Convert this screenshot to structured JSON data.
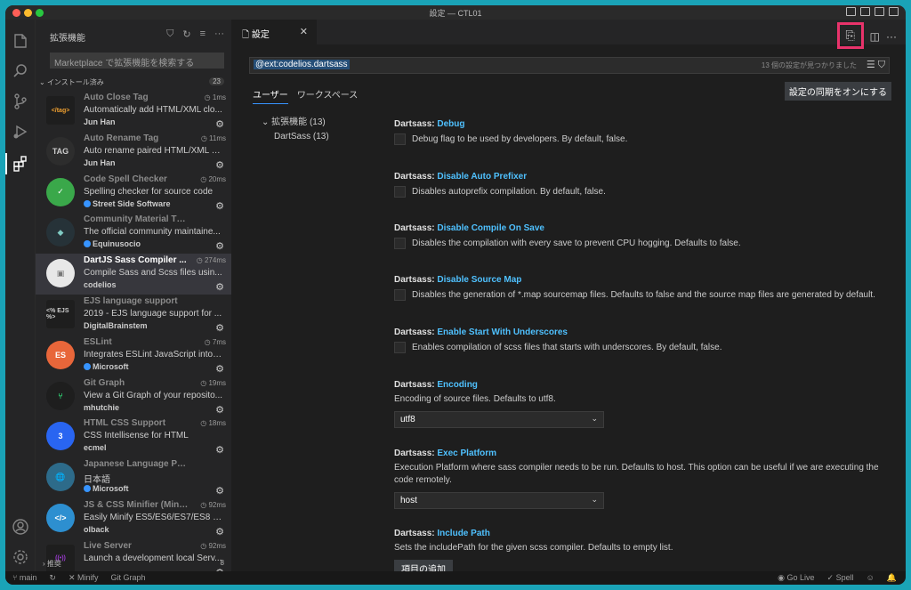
{
  "window": {
    "title": "設定 — CTL01",
    "traffic_colors": [
      "#ff5f57",
      "#febc2e",
      "#28c840"
    ]
  },
  "activity_bar": {
    "items": [
      {
        "name": "explorer-icon",
        "glyph": "❐"
      },
      {
        "name": "search-icon",
        "glyph": "⌕"
      },
      {
        "name": "source-control-icon",
        "glyph": "⑂"
      },
      {
        "name": "run-debug-icon",
        "glyph": "▷"
      },
      {
        "name": "extensions-icon",
        "glyph": "⊞"
      }
    ],
    "bottom": [
      {
        "name": "account-icon",
        "glyph": "◯"
      },
      {
        "name": "manage-gear-icon",
        "glyph": "⚙"
      }
    ]
  },
  "sidebar": {
    "header": "拡張機能",
    "search_placeholder": "Marketplace で拡張機能を検索する",
    "installed_label": "インストール済み",
    "installed_count": "23",
    "recommended_label": "推奨",
    "recommended_count": "8",
    "extensions": [
      {
        "name": "Auto Close Tag",
        "time": "1ms",
        "desc": "Automatically add HTML/XML clo...",
        "publisher": "Jun Han",
        "verified": false,
        "icon_text": "</tag>",
        "icon_bg": "#1e1e1e",
        "icon_color": "#f0a030"
      },
      {
        "name": "Auto Rename Tag",
        "time": "11ms",
        "desc": "Auto rename paired HTML/XML tag",
        "publisher": "Jun Han",
        "verified": false,
        "icon_text": "TAG",
        "icon_bg": "#2d2d2d",
        "icon_color": "#cccccc"
      },
      {
        "name": "Code Spell Checker",
        "time": "20ms",
        "desc": "Spelling checker for source code",
        "publisher": "Street Side Software",
        "verified": true,
        "icon_text": "✓",
        "icon_bg": "#3aa84a",
        "icon_color": "#ffffff"
      },
      {
        "name": "Community Material Theme",
        "time": "",
        "desc": "The official community maintaine...",
        "publisher": "Equinusocio",
        "verified": true,
        "icon_text": "◆",
        "icon_bg": "#263238",
        "icon_color": "#80cbc4"
      },
      {
        "name": "DartJS Sass Compiler ...",
        "time": "274ms",
        "desc": "Compile Sass and Scss files usin...",
        "publisher": "codelios",
        "verified": false,
        "icon_text": "▣",
        "icon_bg": "#e8e8e8",
        "icon_color": "#777777",
        "selected": true
      },
      {
        "name": "EJS language support",
        "time": "",
        "desc": "2019 - EJS language support for ...",
        "publisher": "DigitalBrainstem",
        "verified": false,
        "icon_text": "<% EJS %>",
        "icon_bg": "#1e1e1e",
        "icon_color": "#cccccc"
      },
      {
        "name": "ESLint",
        "time": "7ms",
        "desc": "Integrates ESLint JavaScript into ...",
        "publisher": "Microsoft",
        "verified": true,
        "icon_text": "ES",
        "icon_bg": "#e8663a",
        "icon_color": "#ffffff"
      },
      {
        "name": "Git Graph",
        "time": "19ms",
        "desc": "View a Git Graph of your reposito...",
        "publisher": "mhutchie",
        "verified": false,
        "icon_text": "⑂",
        "icon_bg": "#1e1e1e",
        "icon_color": "#2ecc71"
      },
      {
        "name": "HTML CSS Support",
        "time": "18ms",
        "desc": "CSS Intellisense for HTML",
        "publisher": "ecmel",
        "verified": false,
        "icon_text": "3",
        "icon_bg": "#2965f1",
        "icon_color": "#ffffff"
      },
      {
        "name": "Japanese Language Pack for Vi...",
        "time": "",
        "desc": "日本語",
        "publisher": "Microsoft",
        "verified": true,
        "icon_text": "🌐",
        "icon_bg": "#2d6b8a",
        "icon_color": "#ffffff"
      },
      {
        "name": "JS & CSS Minifier (Minify)",
        "time": "92ms",
        "desc": "Easily Minify ES5/ES6/ES7/ES8 an...",
        "publisher": "olback",
        "verified": false,
        "icon_text": "</>",
        "icon_bg": "#2d8fd0",
        "icon_color": "#ffffff"
      },
      {
        "name": "Live Server",
        "time": "92ms",
        "desc": "Launch a development local Serv...",
        "publisher": "",
        "verified": false,
        "icon_text": "((•))",
        "icon_bg": "#1e1e1e",
        "icon_color": "#9b3ad0"
      }
    ]
  },
  "editor": {
    "tab_label": "設定",
    "query": "@ext:codelios.dartsass",
    "result_count": "13 個の設定が見つかりました",
    "scope_tabs": [
      "ユーザー",
      "ワークスペース"
    ],
    "sync_button": "設定の同期をオンにする",
    "toc": {
      "group": "拡張機能 (13)",
      "child": "DartSass (13)"
    },
    "settings": [
      {
        "prefix": "Dartsass: ",
        "key": "Debug",
        "type": "checkbox",
        "desc": "Debug flag to be used by developers. By default, false."
      },
      {
        "prefix": "Dartsass: ",
        "key": "Disable Auto Prefixer",
        "type": "checkbox",
        "desc": "Disables autoprefix compilation. By default, false."
      },
      {
        "prefix": "Dartsass: ",
        "key": "Disable Compile On Save",
        "type": "checkbox",
        "desc": "Disables the compilation with every save to prevent CPU hogging. Defaults to false."
      },
      {
        "prefix": "Dartsass: ",
        "key": "Disable Source Map",
        "type": "checkbox",
        "desc": "Disables the generation of *.map sourcemap files. Defaults to false and the source map files are generated by default."
      },
      {
        "prefix": "Dartsass: ",
        "key": "Enable Start With Underscores",
        "type": "checkbox",
        "desc": "Enables compilation of scss files that starts with underscores. By default, false."
      },
      {
        "prefix": "Dartsass: ",
        "key": "Encoding",
        "type": "select",
        "desc": "Encoding of source files. Defaults to utf8.",
        "value": "utf8"
      },
      {
        "prefix": "Dartsass: ",
        "key": "Exec Platform",
        "type": "select",
        "desc": "Execution Platform where sass compiler needs to be run. Defaults to host. This option can be useful if we are executing the code remotely.",
        "value": "host"
      },
      {
        "prefix": "Dartsass: ",
        "key": "Include Path",
        "type": "button",
        "desc": "Sets the includePath for the given scss compiler. Defaults to empty list.",
        "button": "項目の追加"
      }
    ]
  },
  "statusbar": {
    "branch": "main",
    "minify": "Minify",
    "git_graph": "Git Graph",
    "go_live": "Go Live",
    "spell": "Spell",
    "errors": "0",
    "warnings": "0"
  },
  "colors": {
    "accent": "#3794ff",
    "setting_key": "#4fc1ff",
    "highlight_box": "#e8336b"
  }
}
